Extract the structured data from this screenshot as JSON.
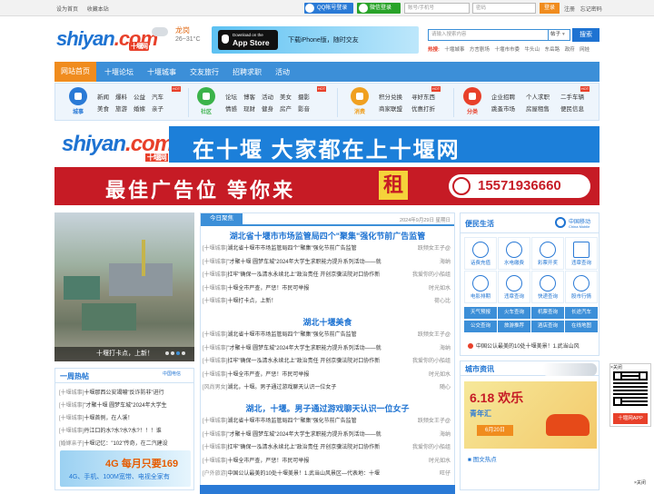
{
  "topbar": {
    "set_home": "设为首页",
    "bookmark": "收藏本站",
    "qq_login": "QQ帐号登录",
    "wechat_login": "微信登录",
    "account_placeholder": "账号/手机号",
    "password_placeholder": "密码",
    "login": "登录",
    "register": "注册",
    "forgot": "忘记密码"
  },
  "header": {
    "logo_main": "shiyan",
    "logo_suffix": ".com",
    "logo_tag": "十堰网",
    "weather_city": "龙岗",
    "weather_temp": "26~31°C",
    "app_download_small": "Download on the",
    "app_store": "App Store",
    "app_text": "下载iPhone版，随时交友",
    "search_placeholder": "请输入搜索内容",
    "search_select": "帖子",
    "search_button": "搜索",
    "hot_label": "热搜:",
    "hot_terms": [
      "十堰城事",
      "方言剧场",
      "十堰市市委",
      "牛头山",
      "东岳路",
      "政府",
      "网娃"
    ]
  },
  "nav": {
    "items": [
      "网站首页",
      "十堰论坛",
      "十堰城事",
      "交友旅行",
      "招聘求职",
      "活动"
    ]
  },
  "categories": [
    {
      "label": "城事",
      "color": "#2a7ad6",
      "links": [
        "新闻",
        "爆料",
        "公益",
        "汽车",
        "美食",
        "旅游",
        "婚嫁",
        "亲子"
      ]
    },
    {
      "label": "社区",
      "color": "#3bb34a",
      "links": [
        "论坛",
        "博客",
        "活动",
        "美女",
        "摄影",
        "情感",
        "现财",
        "健身",
        "房产",
        "影音"
      ]
    },
    {
      "label": "消费",
      "color": "#f0a020",
      "links": [
        "积分兑换",
        "寻好东西",
        "商家联盟",
        "优惠打折"
      ]
    },
    {
      "label": "分类",
      "color": "#e8402a",
      "links": [
        "企业招聘",
        "个人求职",
        "二手车辆",
        "跳蚤市场",
        "房屋租售",
        "便民信息"
      ]
    }
  ],
  "ads": {
    "banner1_logo": "shiyan",
    "banner1_suffix": ".com",
    "banner1_tag": "十堰网",
    "banner1_slogan": "在十堰 大家都在上十堰网",
    "banner2_slogan": "最佳广告位 等你来",
    "banner2_highlight": "租",
    "banner2_phone": "15571936660"
  },
  "photo": {
    "caption": "十堰打卡点，上新！"
  },
  "week_hot": {
    "title": "一周热帖",
    "sponsor": "中国电信",
    "items": [
      {
        "cat": "[十堰城事]",
        "text": "十堰那西公安竭嘣\"反诈防非\"进行"
      },
      {
        "cat": "[十堰城事]",
        "text": "\"才聚十堰 圆梦车城\"2024年大学生"
      },
      {
        "cat": "[十堰城事]",
        "text": "十堰首例，在人溪！"
      },
      {
        "cat": "[十堰城事]",
        "text": "丹江口的水?水?水?水?！！！谁"
      },
      {
        "cat": "[婚嫁亲子]",
        "text": "十堰记忆：\"102\"传奇，在二汽建设"
      }
    ],
    "promo_a": "4G 每月只要169",
    "promo_b": "4G、手机、100M宽带、电视全家有"
  },
  "today": {
    "tab": "今日聚焦",
    "date": "2024年9月29日 星期日",
    "sections": [
      {
        "headline": "湖北省十堰市市场监管局四个\"聚集\"强化节前广告监管",
        "rows": [
          {
            "cat": "[十堰城事]",
            "text": "湖北省十堰市市场监管局四个\"聚集\"强化节前广告监管",
            "author": "跃频女王子@"
          },
          {
            "cat": "[十堰城事]",
            "text": "\"才聚十堰 圆梦车城\"2024年大学生求职能力提升系列活动——就",
            "author": "海纳"
          },
          {
            "cat": "[十堰城事]",
            "text": "扛牢\"确保一泓清水永续北上\"政治责任 开创京骥法院对口协作新",
            "author": "我爱你的小船组"
          },
          {
            "cat": "[十堰城事]",
            "text": "十堰全市严查，严惩！市民可举报",
            "author": "时光如水"
          },
          {
            "cat": "[十堰城事]",
            "text": "十堰打卡点，上新！",
            "author": "荷心比"
          }
        ]
      },
      {
        "headline": "湖北十堰美食",
        "rows": [
          {
            "cat": "[十堰城事]",
            "text": "湖北省十堰市市场监管局四个\"聚集\"强化节前广告监管",
            "author": "跃频女王子@"
          },
          {
            "cat": "[十堰城事]",
            "text": "\"才聚十堰 圆梦车城\"2024年大学生求职能力提升系列活动——就",
            "author": "海纳"
          },
          {
            "cat": "[十堰城事]",
            "text": "扛牢\"确保一泓清水永续北上\"政治责任 开创京骥法院对口协作新",
            "author": "我爱你的小船组"
          },
          {
            "cat": "[十堰城事]",
            "text": "十堰全市严查，严惩！市民可举报",
            "author": "时光如水"
          },
          {
            "cat": "[风尚男女]",
            "text": "湖北，十堰。男子通过游戏聊天认识一位女子",
            "author": "随心"
          }
        ]
      },
      {
        "headline": "湖北，十堰。男子通过游戏聊天认识一位女子",
        "rows": [
          {
            "cat": "[十堰城事]",
            "text": "湖北省十堰市市场监管局四个\"聚集\"强化节前广告监管",
            "author": "跃频女王子@"
          },
          {
            "cat": "[十堰城事]",
            "text": "\"才聚十堰 圆梦车城\"2024年大学生求职能力提升系列活动——就",
            "author": "海纳"
          },
          {
            "cat": "[十堰城事]",
            "text": "扛牢\"确保一泓清水永续北上\"政治责任 开创京骥法院对口协作新",
            "author": "我爱你的小船组"
          },
          {
            "cat": "[十堰城事]",
            "text": "十堰全市严查，严惩！市民可举报",
            "author": "时光如水"
          },
          {
            "cat": "[户外旅游]",
            "text": "中国公认最美的10处十堰美景！1.武当山风景区—代表地：十堰",
            "author": "旺仔"
          }
        ]
      }
    ]
  },
  "life": {
    "title": "便民生活",
    "sponsor": "中国移动",
    "sponsor_en": "China Mobile",
    "services": [
      "话费充值",
      "水电缴费",
      "彩票开奖",
      "违章查询",
      "电影排期",
      "违章查询",
      "快递查询",
      "股市行情"
    ],
    "quick": [
      "天气预报",
      "火车查询",
      "机票查询",
      "长途汽车",
      "公交查询",
      "旅游推荐",
      "酒店查询",
      "在线地图"
    ],
    "news": "中国公认最美的10处十堰美景！1.武当山风"
  },
  "city": {
    "title": "城市资讯",
    "ad_a": "6.18 欢乐",
    "ad_b": "青年汇",
    "ad_date": "6月20日",
    "pic_news": "图文热点"
  },
  "qr": {
    "close": "关闭",
    "app": "十堰网APP"
  },
  "bottom_close": "关闭"
}
